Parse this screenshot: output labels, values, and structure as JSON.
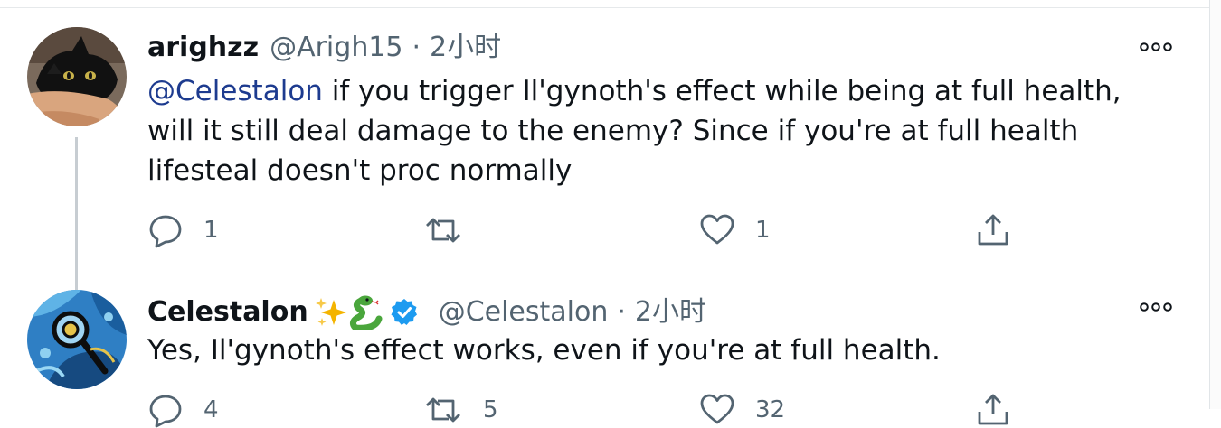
{
  "tweets": [
    {
      "display_name": "arighzz",
      "handle": "@Arigh15",
      "separator": "·",
      "time": "2小时",
      "mention": "@Celestalon",
      "text": " if you trigger Il'gynoth's effect while being at full health, will it still deal damage to the enemy? Since if you're at full health lifesteal doesn't proc normally",
      "reply_count": "1",
      "retweet_count": "",
      "like_count": "1",
      "avatar_icon": "black-cat-avatar",
      "more_icon": "more-dots-icon"
    },
    {
      "display_name": "Celestalon",
      "handle": "@Celestalon",
      "separator": "·",
      "time": "2小时",
      "text": "Yes, Il'gynoth's effect works, even if you're at full health.",
      "reply_count": "4",
      "retweet_count": "5",
      "like_count": "32",
      "name_emojis": [
        "sparkles-icon",
        "snake-icon"
      ],
      "verified": true,
      "avatar_icon": "blue-art-avatar",
      "more_icon": "more-dots-icon"
    }
  ],
  "colors": {
    "text": "#0f1419",
    "secondary": "#536471",
    "verified": "#1d9bf0",
    "thread_line": "#c7cdd2"
  }
}
